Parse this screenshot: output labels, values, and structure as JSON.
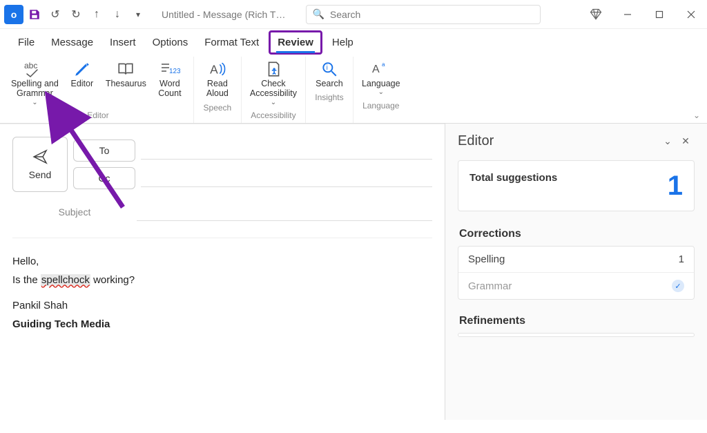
{
  "titlebar": {
    "title": "Untitled  -  Message (Rich T…",
    "search_placeholder": "Search"
  },
  "tabs": {
    "file": "File",
    "message": "Message",
    "insert": "Insert",
    "options": "Options",
    "format_text": "Format Text",
    "review": "Review",
    "help": "Help"
  },
  "ribbon": {
    "spelling_grammar": "Spelling and\nGrammar",
    "editor": "Editor",
    "thesaurus": "Thesaurus",
    "word_count": "Word\nCount",
    "read_aloud": "Read\nAloud",
    "check_accessibility": "Check\nAccessibility",
    "search": "Search",
    "language": "Language",
    "groups": {
      "editor": "Editor",
      "speech": "Speech",
      "accessibility": "Accessibility",
      "insights": "Insights",
      "language": "Language"
    }
  },
  "compose": {
    "send": "Send",
    "to": "To",
    "cc": "Cc",
    "subject": "Subject",
    "body_line1": "Hello,",
    "body_line2a": "Is the ",
    "body_misspell": "spellchock",
    "body_line2b": " working?",
    "body_line3": "Pankil Shah",
    "body_line4": "Guiding Tech Media"
  },
  "editor_pane": {
    "title": "Editor",
    "total_label": "Total suggestions",
    "total_value": "1",
    "corrections_header": "Corrections",
    "spelling_label": "Spelling",
    "spelling_count": "1",
    "grammar_label": "Grammar",
    "refinements_header": "Refinements"
  }
}
